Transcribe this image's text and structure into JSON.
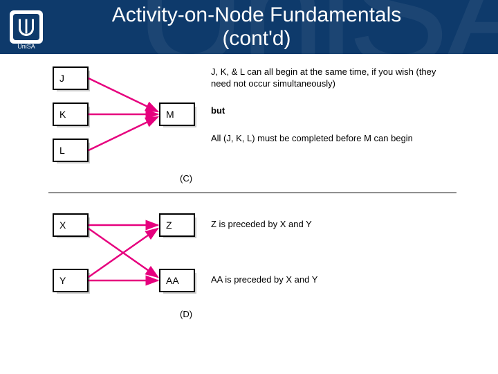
{
  "header": {
    "watermark": "UniSA",
    "logo_caption": "UniSA",
    "title_line1": "Activity-on-Node Fundamentals",
    "title_line2": "(cont'd)"
  },
  "diagram_c": {
    "nodes": {
      "j": "J",
      "k": "K",
      "l": "L",
      "m": "M"
    },
    "desc1": "J, K, & L can all begin at the same time, if you wish (they need not occur simultaneously)",
    "desc_but": "but",
    "desc2": "All (J, K, L) must be completed before M can begin",
    "caption": "(C)"
  },
  "diagram_d": {
    "nodes": {
      "x": "X",
      "y": "Y",
      "z": "Z",
      "aa": "AA"
    },
    "desc_z": "Z is preceded by X and Y",
    "desc_aa": "AA is preceded by X and Y",
    "caption": "(D)"
  },
  "chart_data": [
    {
      "type": "network",
      "label": "(C)",
      "nodes": [
        "J",
        "K",
        "L",
        "M"
      ],
      "edges": [
        [
          "J",
          "M"
        ],
        [
          "K",
          "M"
        ],
        [
          "L",
          "M"
        ]
      ],
      "annotations": [
        "J, K, & L can all begin at the same time, if you wish (they need not occur simultaneously)",
        "but",
        "All (J, K, L) must be completed before M can begin"
      ]
    },
    {
      "type": "network",
      "label": "(D)",
      "nodes": [
        "X",
        "Y",
        "Z",
        "AA"
      ],
      "edges": [
        [
          "X",
          "Z"
        ],
        [
          "X",
          "AA"
        ],
        [
          "Y",
          "Z"
        ],
        [
          "Y",
          "AA"
        ]
      ],
      "annotations": [
        "Z is preceded by X and Y",
        "AA is preceded by X and Y"
      ]
    }
  ]
}
